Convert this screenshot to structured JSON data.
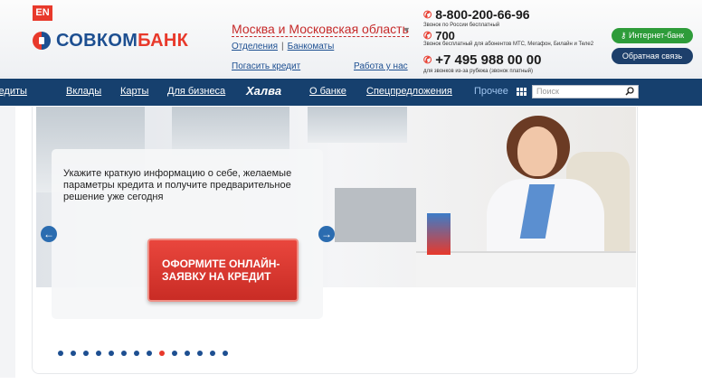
{
  "header": {
    "lang_label": "EN",
    "logo": {
      "part1": "СОВКОМ",
      "part2": "БАНК"
    },
    "region": "Москва и Московская область",
    "links": [
      "Отделения",
      "Банкоматы"
    ],
    "link_separator": "|",
    "repay_label": "Погасить кредит",
    "jobs_label": "Работа у нас",
    "phones": [
      {
        "number": "8-800-200-66-96",
        "note": "Звонок по России бесплатный"
      },
      {
        "number": "700",
        "note": "Звонок бесплатный для абонентов МТС, Мегафон, Билайн и Теле2"
      },
      {
        "number": "+7 495 988 00 00",
        "note": "для звонков из-за рубежа (звонок платный)"
      }
    ],
    "internet_bank_label": "Интернет-банк",
    "feedback_label": "Обратная связь"
  },
  "nav": {
    "items": [
      "Кредиты",
      "Вклады",
      "Карты",
      "Для бизнеса",
      "Халва",
      "О банке",
      "Спецпредложения",
      "Прочее"
    ],
    "search_placeholder": "Поиск"
  },
  "banner": {
    "promo_text": "Укажите краткую информацию о себе, желаемые параметры кредита и получите предварительное решение уже сегодня",
    "cta_label": "ОФОРМИТЕ ОНЛАЙН-ЗАЯВКУ НА КРЕДИТ",
    "slide_count": 14,
    "active_slide": 9
  },
  "colors": {
    "brand_blue": "#1d4f91",
    "brand_red": "#e8392b",
    "nav_bg": "#16406e",
    "internet_bank_green": "#2e9c3a"
  }
}
